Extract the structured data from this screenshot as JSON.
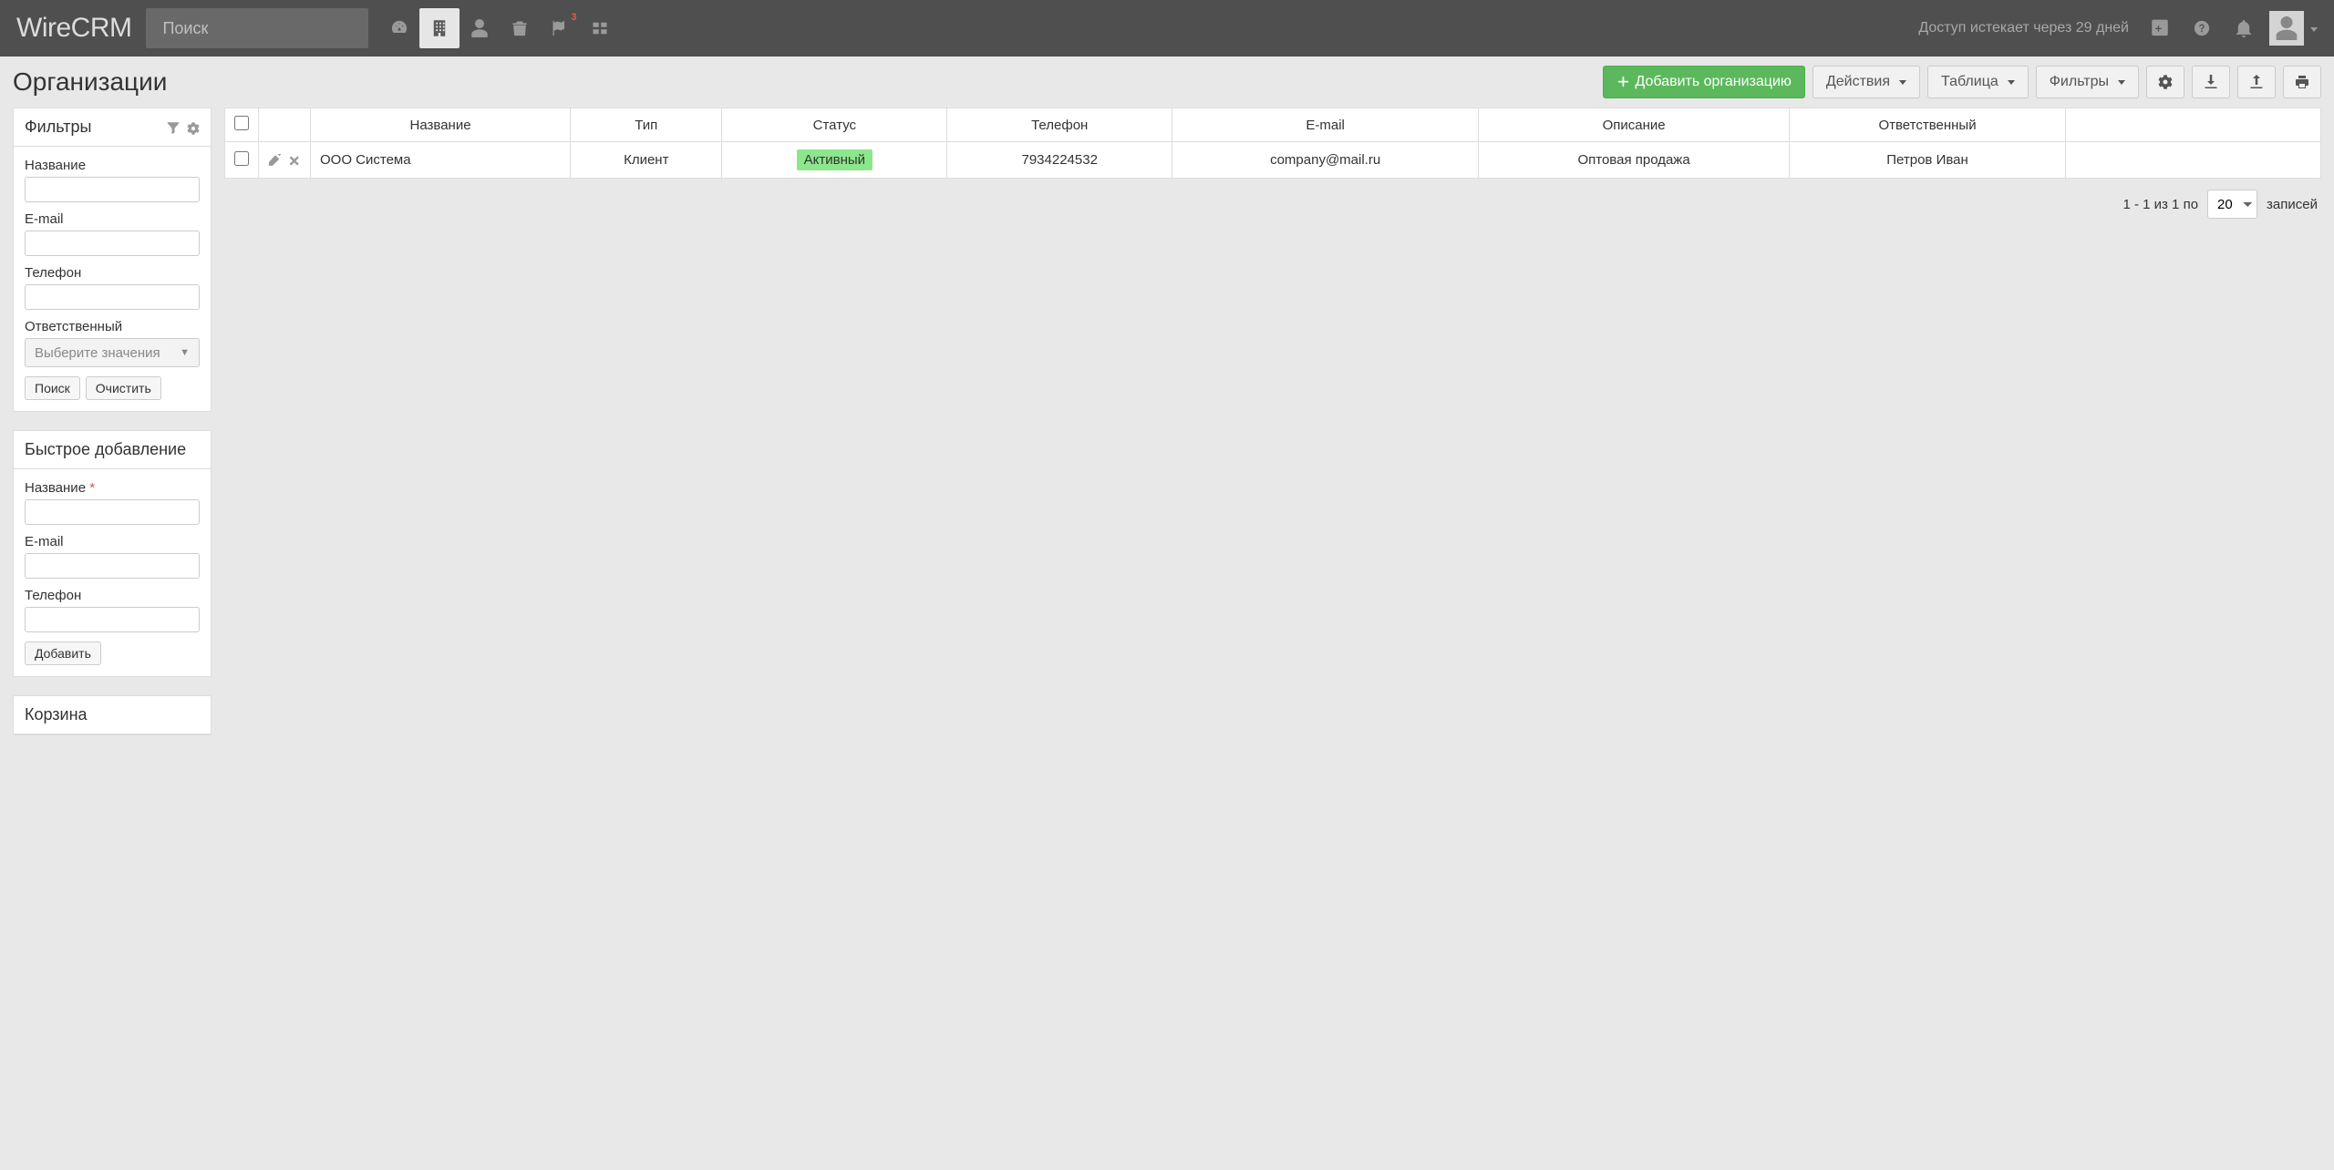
{
  "navbar": {
    "brand": "WireCRM",
    "searchPlaceholder": "Поиск",
    "flagBadge": "3",
    "expiryText": "Доступ истекает через 29 дней"
  },
  "page": {
    "title": "Организации"
  },
  "toolbar": {
    "addOrg": "Добавить организацию",
    "actions": "Действия",
    "table": "Таблица",
    "filters": "Фильтры"
  },
  "filtersPanel": {
    "title": "Фильтры",
    "nameLabel": "Название",
    "emailLabel": "E-mail",
    "phoneLabel": "Телефон",
    "responsibleLabel": "Ответственный",
    "responsiblePlaceholder": "Выберите значения",
    "searchBtn": "Поиск",
    "clearBtn": "Очистить"
  },
  "quickAdd": {
    "title": "Быстрое добавление",
    "nameLabel": "Название",
    "emailLabel": "E-mail",
    "phoneLabel": "Телефон",
    "addBtn": "Добавить"
  },
  "trash": {
    "title": "Корзина"
  },
  "tableHead": {
    "name": "Название",
    "type": "Тип",
    "status": "Статус",
    "phone": "Телефон",
    "email": "E-mail",
    "description": "Описание",
    "responsible": "Ответственный"
  },
  "rows": [
    {
      "name": "ООО Система",
      "type": "Клиент",
      "status": "Активный",
      "phone": "7934224532",
      "email": "company@mail.ru",
      "description": "Оптовая продажа",
      "responsible": "Петров Иван"
    }
  ],
  "pagination": {
    "range": "1 - 1 из 1 по",
    "pageSize": "20",
    "suffix": "записей"
  }
}
